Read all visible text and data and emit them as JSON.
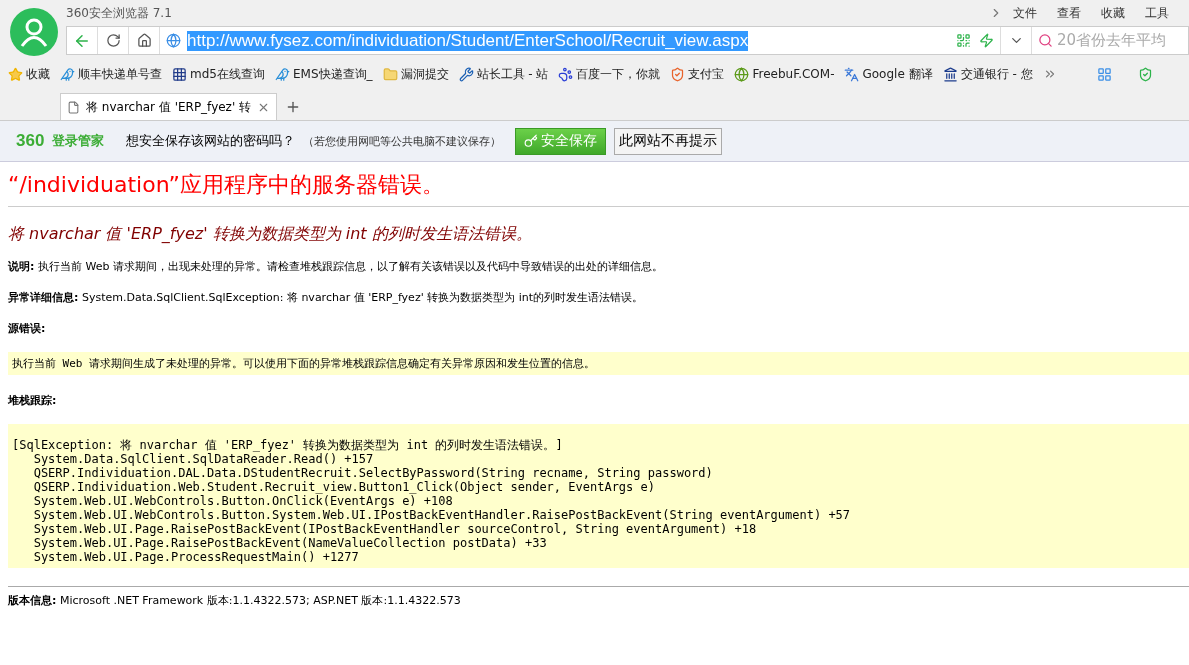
{
  "browser": {
    "title": "360安全浏览器 7.1",
    "menu": [
      "文件",
      "查看",
      "收藏",
      "工具"
    ],
    "url": "http://www.fysez.com/individuation/Student/EnterSchool/Recruit_view.aspx",
    "search_placeholder": "20省份去年平均"
  },
  "bookmarks": [
    {
      "label": "收藏",
      "kind": "favorites"
    },
    {
      "label": "顺丰快递单号查",
      "kind": "bird"
    },
    {
      "label": "md5在线查询",
      "kind": "grid"
    },
    {
      "label": "EMS快递查询_",
      "kind": "bird"
    },
    {
      "label": "漏洞提交",
      "kind": "folder"
    },
    {
      "label": "站长工具 - 站",
      "kind": "tool"
    },
    {
      "label": "百度一下，你就",
      "kind": "paw"
    },
    {
      "label": "支付宝",
      "kind": "shield"
    },
    {
      "label": "FreebuF.COM-",
      "kind": "letter"
    },
    {
      "label": "Google 翻译",
      "kind": "translate"
    },
    {
      "label": "交通银行 - 您",
      "kind": "bank"
    }
  ],
  "tabs": [
    {
      "label": "将 nvarchar 值 'ERP_fyez' 转",
      "selected": true
    }
  ],
  "password_bar": {
    "brand": "360",
    "brand_label": "登录管家",
    "question": "想安全保存该网站的密码吗？",
    "note": "（若您使用网吧等公共电脑不建议保存）",
    "save_button": "安全保存",
    "dismiss_button": "此网站不再提示"
  },
  "page": {
    "heading": "“/individuation”应用程序中的服务器错误。",
    "error_title": "将 nvarchar 值 'ERP_fyez' 转换为数据类型为 int 的列时发生语法错误。",
    "description_label": "说明:",
    "description": "执行当前 Web 请求期间，出现未处理的异常。请检查堆栈跟踪信息，以了解有关该错误以及代码中导致错误的出处的详细信息。",
    "details_label": "异常详细信息:",
    "details": "System.Data.SqlClient.SqlException: 将 nvarchar 值 'ERP_fyez' 转换为数据类型为 int的列时发生语法错误。",
    "source_label": "源错误:",
    "source_text": "执行当前 Web 请求期间生成了未处理的异常。可以使用下面的异常堆栈跟踪信息确定有关异常原因和发生位置的信息。",
    "stack_label": "堆栈跟踪:",
    "stack_lines": [
      "[SqlException: 将 nvarchar 值 'ERP_fyez' 转换为数据类型为 int 的列时发生语法错误。]",
      "   System.Data.SqlClient.SqlDataReader.Read() +157",
      "   QSERP.Individuation.DAL.Data.DStudentRecruit.SelectByPassword(String recname, String password)",
      "   QSERP.Individuation.Web.Student.Recruit_view.Button1_Click(Object sender, EventArgs e)",
      "   System.Web.UI.WebControls.Button.OnClick(EventArgs e) +108",
      "   System.Web.UI.WebControls.Button.System.Web.UI.IPostBackEventHandler.RaisePostBackEvent(String eventArgument) +57",
      "   System.Web.UI.Page.RaisePostBackEvent(IPostBackEventHandler sourceControl, String eventArgument) +18",
      "   System.Web.UI.Page.RaisePostBackEvent(NameValueCollection postData) +33",
      "   System.Web.UI.Page.ProcessRequestMain() +1277"
    ],
    "version_label": "版本信息:",
    "version": "Microsoft .NET Framework 版本:1.1.4322.573; ASP.NET 版本:1.1.4322.573"
  }
}
